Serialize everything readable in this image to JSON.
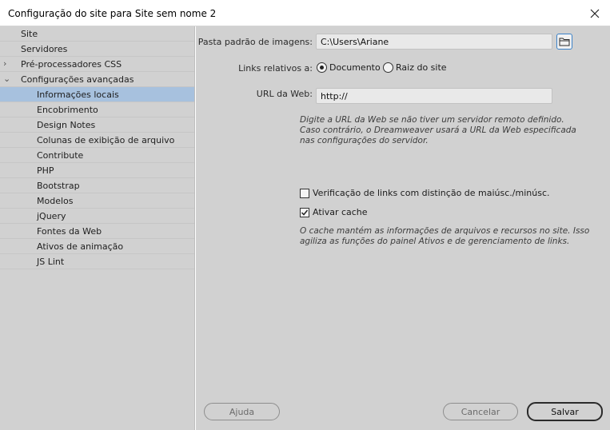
{
  "window": {
    "title": "Configuração do site para Site sem nome 2"
  },
  "sidebar": {
    "items": [
      {
        "label": "Site"
      },
      {
        "label": "Servidores"
      },
      {
        "label": "Pré-processadores CSS"
      },
      {
        "label": "Configurações avançadas"
      },
      {
        "label": "Informações locais"
      },
      {
        "label": "Encobrimento"
      },
      {
        "label": "Design Notes"
      },
      {
        "label": "Colunas de exibição de arquivo"
      },
      {
        "label": "Contribute"
      },
      {
        "label": "PHP"
      },
      {
        "label": "Bootstrap"
      },
      {
        "label": "Modelos"
      },
      {
        "label": "jQuery"
      },
      {
        "label": "Fontes da Web"
      },
      {
        "label": "Ativos de animação"
      },
      {
        "label": "JS Lint"
      }
    ],
    "selected": "Informações locais"
  },
  "form": {
    "image_folder_label": "Pasta padrão de imagens:",
    "image_folder_value": "C:\\Users\\Ariane",
    "links_label": "Links relativos a:",
    "radio_document": "Documento",
    "radio_site_root": "Raiz do site",
    "url_label": "URL da Web:",
    "url_value": "http://",
    "url_hint_1": "Digite a URL da Web se não tiver um servidor remoto definido.",
    "url_hint_2": "Caso contrário, o Dreamweaver usará a URL da Web especificada",
    "url_hint_3": "nas configurações do servidor.",
    "case_check_label": "Verificação de links com distinção de maiúsc./minúsc.",
    "cache_label": "Ativar cache",
    "cache_hint_1": "O cache mantém as informações de arquivos e recursos no site. Isso",
    "cache_hint_2": "agiliza as funções do painel Ativos e de gerenciamento de links."
  },
  "footer": {
    "help": "Ajuda",
    "cancel": "Cancelar",
    "save": "Salvar"
  }
}
